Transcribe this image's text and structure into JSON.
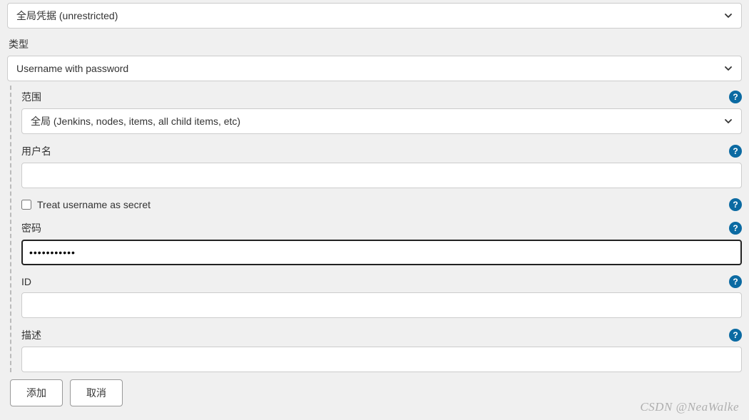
{
  "store": {
    "selected": "全局凭据 (unrestricted)"
  },
  "kindSection": {
    "label": "类型",
    "selected": "Username with password"
  },
  "fields": {
    "scope": {
      "label": "范围",
      "selected": "全局 (Jenkins, nodes, items, all child items, etc)"
    },
    "username": {
      "label": "用户名",
      "value": ""
    },
    "treatSecret": {
      "label": "Treat username as secret",
      "checked": false
    },
    "password": {
      "label": "密码",
      "value": "•••••••••••"
    },
    "id": {
      "label": "ID",
      "value": ""
    },
    "description": {
      "label": "描述",
      "value": ""
    }
  },
  "buttons": {
    "add": "添加",
    "cancel": "取消"
  },
  "helpGlyph": "?",
  "watermark": "CSDN @NeaWalke"
}
